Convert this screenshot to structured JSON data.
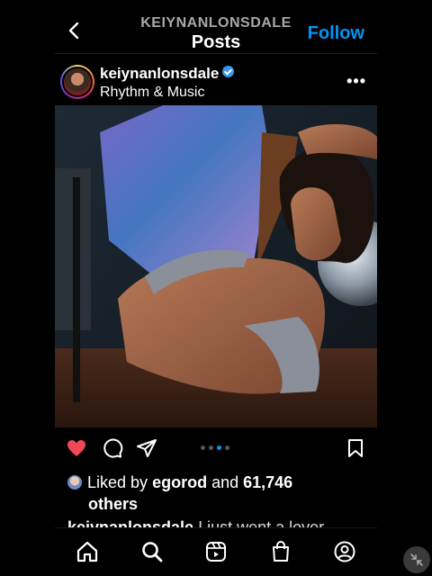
{
  "header": {
    "username": "KEIYNANLONSDALE",
    "title": "Posts",
    "follow_label": "Follow"
  },
  "post": {
    "author": "keiynanlonsdale",
    "subtitle": "Rhythm & Music",
    "more_label": "•••",
    "likes": {
      "prefix": "Liked by",
      "user": "egorod",
      "and": "and",
      "count": "61,746",
      "suffix": "others"
    },
    "caption": {
      "author": "keiynanlonsdale",
      "text": "I just went a lover..."
    },
    "carousel": {
      "total": 4,
      "active": 3
    }
  },
  "colors": {
    "accent": "#0095f6",
    "like": "#ed4956"
  },
  "icons": {
    "back": "chevron-left-icon",
    "like": "heart-icon",
    "comment": "comment-icon",
    "share": "send-icon",
    "save": "bookmark-icon",
    "tabs": [
      "home-icon",
      "search-icon",
      "reels-icon",
      "shop-icon",
      "profile-icon"
    ]
  }
}
